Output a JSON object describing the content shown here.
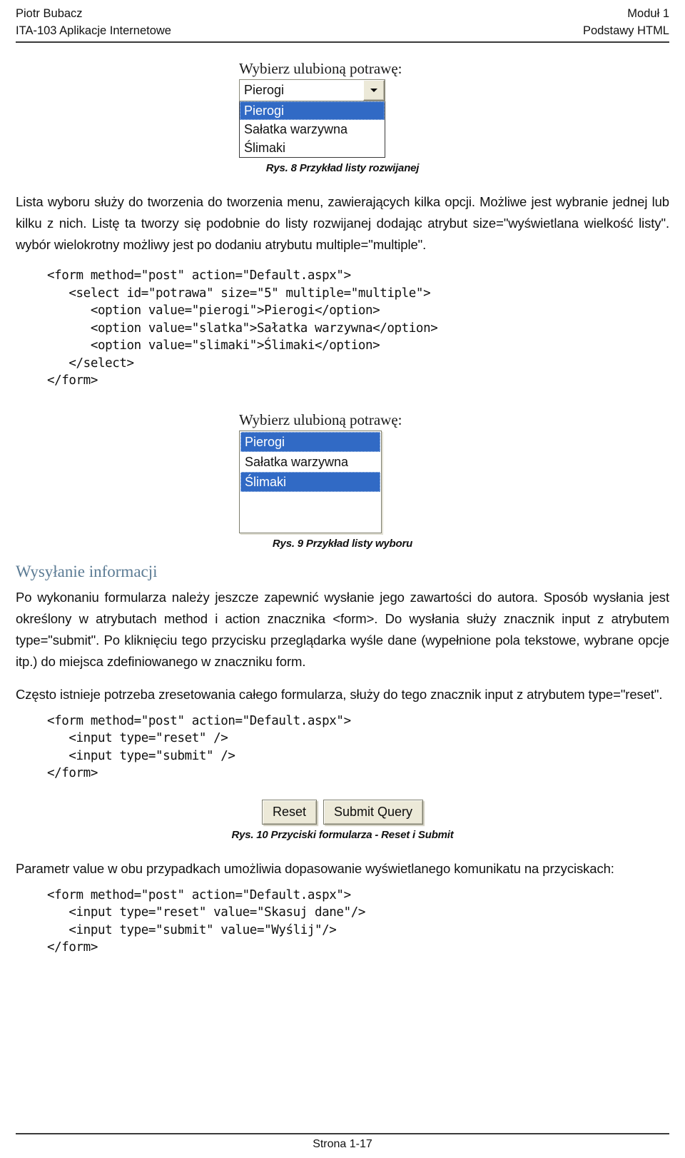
{
  "header": {
    "author": "Piotr Bubacz",
    "course": "ITA-103 Aplikacje Internetowe",
    "module": "Moduł 1",
    "topic": "Podstawy HTML"
  },
  "figure8": {
    "label": "Wybierz ulubioną potrawę:",
    "combo_value": "Pierogi",
    "arrow_icon": "chevron-down-icon",
    "options": [
      {
        "text": "Pierogi",
        "selected": true
      },
      {
        "text": "Sałatka warzywna",
        "selected": false
      },
      {
        "text": "Ślimaki",
        "selected": false
      }
    ],
    "caption": "Rys. 8 Przykład listy rozwijanej"
  },
  "paragraph1": "Lista wyboru służy do tworzenia do tworzenia menu, zawierających kilka opcji. Możliwe jest wybranie jednej lub kilku z nich. Listę ta tworzy się podobnie do listy rozwijanej dodając atrybut size=\"wyświetlana wielkość listy\". wybór wielokrotny możliwy jest po dodaniu atrybutu multiple=\"multiple\".",
  "code1": "<form method=\"post\" action=\"Default.aspx\">\n   <select id=\"potrawa\" size=\"5\" multiple=\"multiple\">\n      <option value=\"pierogi\">Pierogi</option>\n      <option value=\"slatka\">Sałatka warzywna</option>\n      <option value=\"slimaki\">Ślimaki</option>\n   </select>\n</form>",
  "figure9": {
    "label": "Wybierz ulubioną potrawę:",
    "options": [
      {
        "text": "Pierogi",
        "selected": true
      },
      {
        "text": "Sałatka warzywna",
        "selected": false
      },
      {
        "text": "Ślimaki",
        "selected": true
      },
      {
        "text": "",
        "selected": false
      },
      {
        "text": "",
        "selected": false
      }
    ],
    "caption": "Rys. 9 Przykład listy wyboru"
  },
  "section": {
    "heading": "Wysyłanie informacji",
    "paragraph2": "Po wykonaniu formularza należy jeszcze zapewnić wysłanie jego zawartości do autora. Sposób wysłania jest określony w atrybutach method i action znacznika <form>. Do wysłania służy znacznik input z atrybutem type=\"submit\". Po kliknięciu tego przycisku przeglądarka wyśle dane (wypełnione pola tekstowe, wybrane opcje itp.) do miejsca zdefiniowanego w znaczniku form.",
    "paragraph3": "Często istnieje potrzeba zresetowania całego formularza, służy do tego znacznik input z atrybutem type=\"reset\"."
  },
  "code2": "<form method=\"post\" action=\"Default.aspx\">\n   <input type=\"reset\" />\n   <input type=\"submit\" />\n</form>",
  "figure10": {
    "reset_label": "Reset",
    "submit_label": "Submit Query",
    "caption": "Rys. 10 Przyciski formularza - Reset i Submit"
  },
  "paragraph4": "Parametr value w obu przypadkach umożliwia dopasowanie wyświetlanego komunikatu na przyciskach:",
  "code3": "<form method=\"post\" action=\"Default.aspx\">\n   <input type=\"reset\" value=\"Skasuj dane\"/>\n   <input type=\"submit\" value=\"Wyślij\"/>\n</form>",
  "footer": {
    "page": "Strona 1-17"
  },
  "colors": {
    "heading": "#5b7b94",
    "selection": "#316ac5",
    "button_face": "#ece9d8",
    "rule": "#3a3a3a"
  }
}
